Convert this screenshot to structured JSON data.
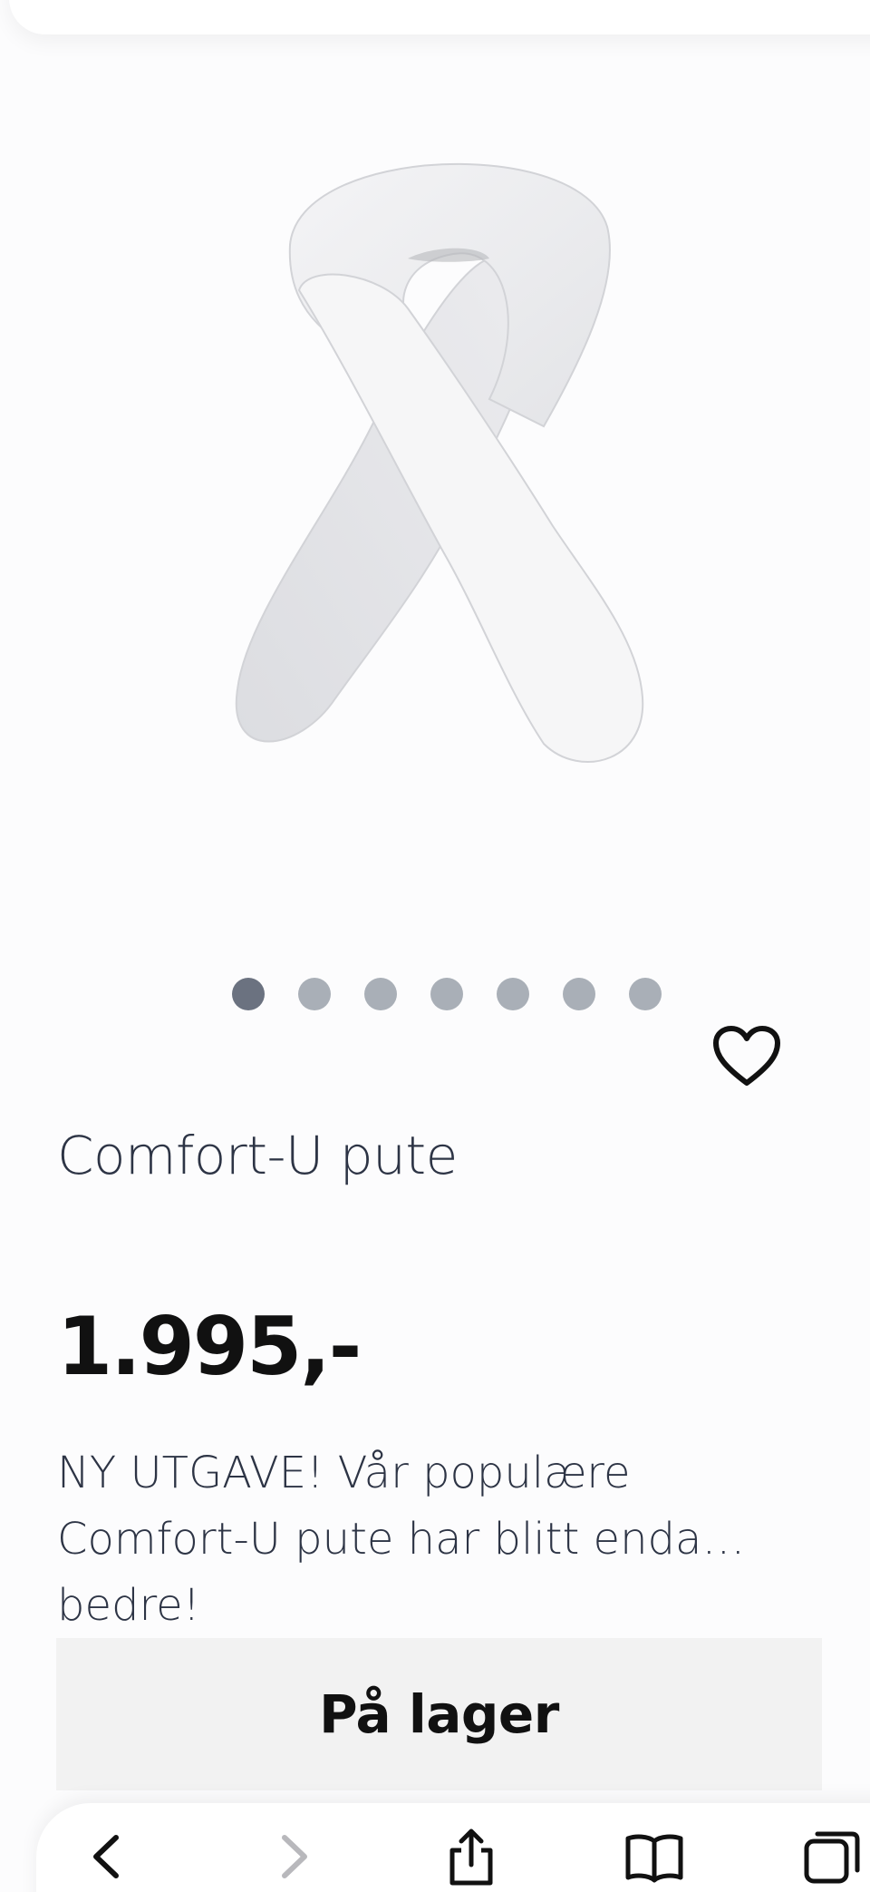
{
  "product": {
    "title": "Comfort-U pute",
    "price": "1.995,-",
    "description": "NY UTGAVE! Vår populære Comfort-U pute har blitt enda… bedre!",
    "stock_label": "På lager",
    "image_alt": "Comfort-U pute",
    "image_count": 7,
    "active_image": 1
  },
  "icons": {
    "favorite": "heart-icon",
    "back": "chevron-left-icon",
    "forward": "chevron-right-icon",
    "share": "share-icon",
    "bookmarks": "book-icon",
    "tabs": "tabs-icon"
  },
  "colors": {
    "dot_active": "#6b7280",
    "dot_inactive": "#a9afb7",
    "stock_bg": "#f2f2f2",
    "title_text": "#2d3445"
  }
}
